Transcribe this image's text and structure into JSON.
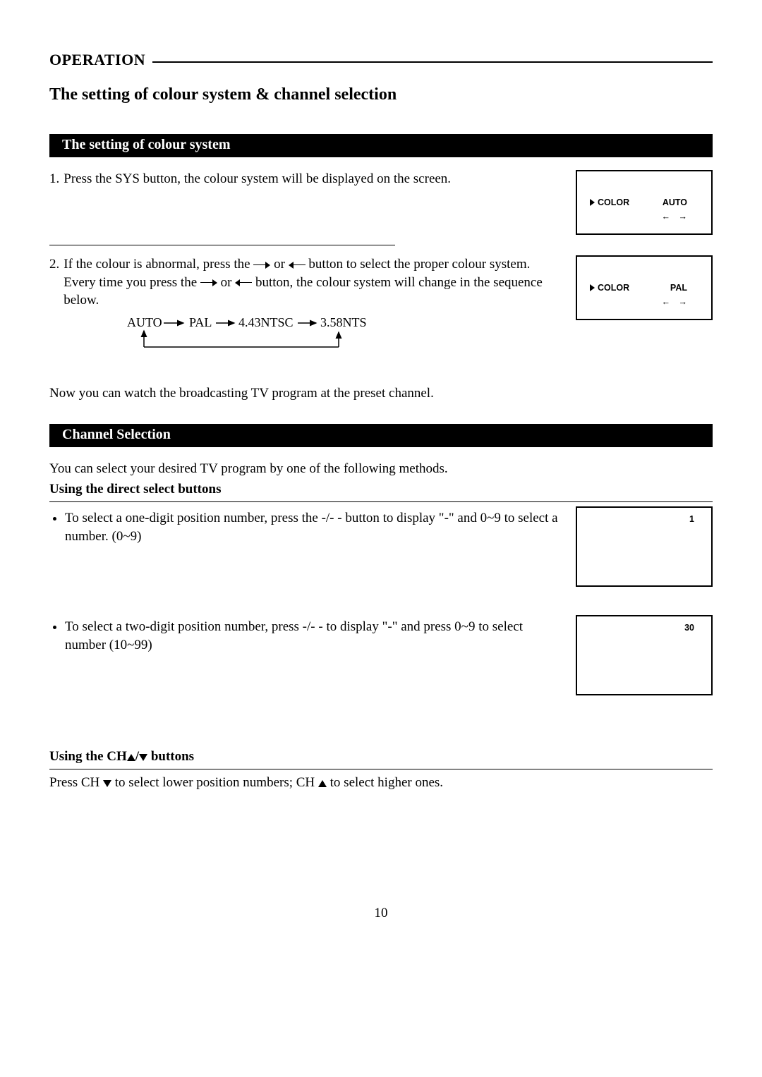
{
  "header": {
    "label": "OPERATION"
  },
  "title": "The setting of colour system & channel selection",
  "section1": {
    "heading": "The setting of colour system",
    "step1_num": "1.",
    "step1_text": "Press the SYS button, the colour system will be displayed on the screen.",
    "screen1_label": "COLOR",
    "screen1_value": "AUTO",
    "step2_num": "2.",
    "step2_a": "If the colour is abnormal, press the",
    "step2_b": "or",
    "step2_c": "button to select the proper colour system. Every time you press the",
    "step2_d": "or",
    "step2_e": "button, the colour system will change in the sequence below.",
    "screen2_label": "COLOR",
    "screen2_value": "PAL",
    "seq": {
      "a": "AUTO",
      "b": "PAL",
      "c": "4.43NTSC",
      "d": "3.58NTSC"
    },
    "after": "Now you can watch the broadcasting TV program at the preset channel."
  },
  "section2": {
    "heading": "Channel Selection",
    "intro": "You can select your desired TV program by one of the following methods.",
    "sub1_heading": "Using the direct select buttons",
    "bullet1": "To select a one-digit position number, press the -/- - button to display \"-\" and 0~9 to select a number. (0~9)",
    "screen3_value": "1",
    "bullet2": "To select a two-digit position number, press -/- - to display \"-\" and press 0~9 to select number (10~99)",
    "screen4_value": "30",
    "sub2_heading_a": "Using the CH",
    "sub2_heading_b": "/",
    "sub2_heading_c": "buttons",
    "sub2_text_a": "Press CH",
    "sub2_text_b": "to select lower position numbers; CH",
    "sub2_text_c": "to select higher ones."
  },
  "page_number": "10"
}
